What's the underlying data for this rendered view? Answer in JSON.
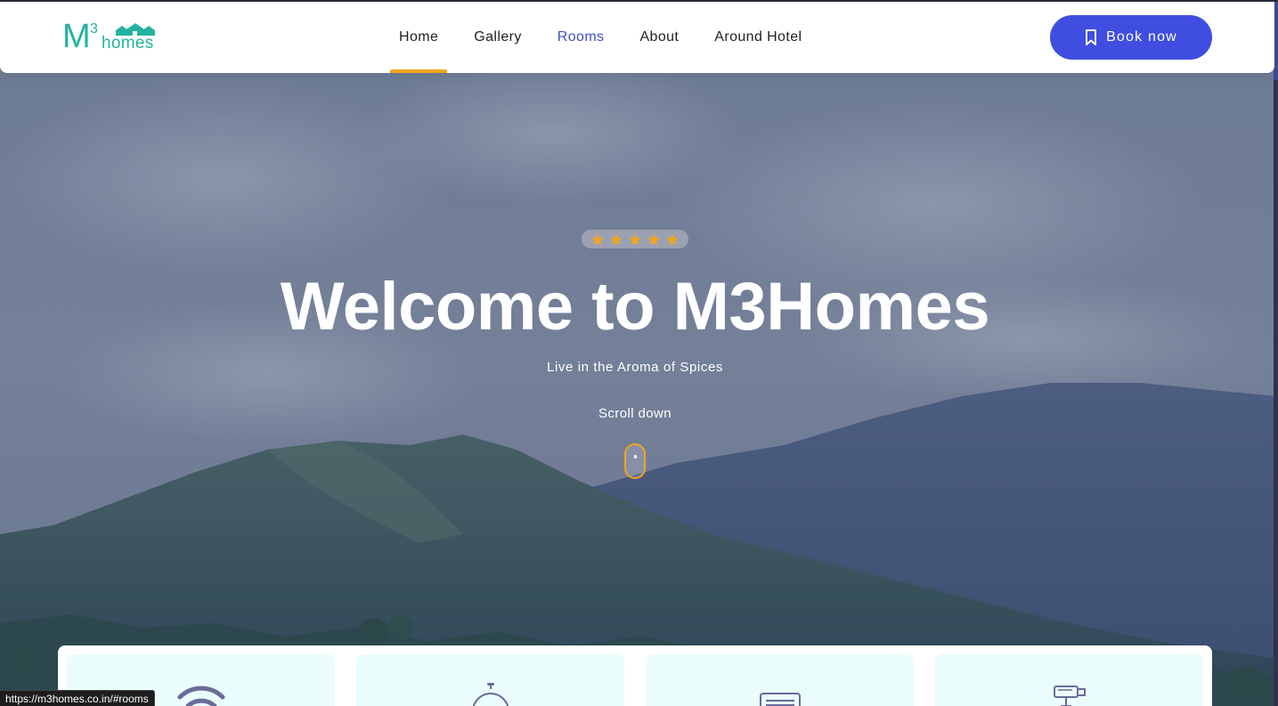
{
  "brand": {
    "logo_m": "M",
    "logo_three": "3",
    "logo_homes": "homes",
    "color": "#24b3a0"
  },
  "nav": {
    "items": [
      {
        "label": "Home",
        "active": true
      },
      {
        "label": "Gallery",
        "active": false
      },
      {
        "label": "Rooms",
        "active": false,
        "hover": true
      },
      {
        "label": "About",
        "active": false
      },
      {
        "label": "Around Hotel",
        "active": false
      }
    ],
    "accent_color": "#f0a51e",
    "hover_color": "#3e4fc8"
  },
  "book_button": {
    "label": "Book now",
    "icon": "bookmark-icon",
    "color": "#3f4ee0"
  },
  "hero": {
    "rating": 5,
    "star_icon": "star-icon",
    "title": "Welcome to M3Homes",
    "subtitle": "Live in the Aroma of Spices",
    "scroll_label": "Scroll down",
    "scroll_icon": "mouse-scroll-icon"
  },
  "features": [
    {
      "icon": "wifi-icon"
    },
    {
      "icon": "room-service-bell-icon"
    },
    {
      "icon": "air-conditioner-icon"
    },
    {
      "icon": "cctv-camera-icon"
    }
  ],
  "status_bar": {
    "url": "https://m3homes.co.in/#rooms"
  }
}
